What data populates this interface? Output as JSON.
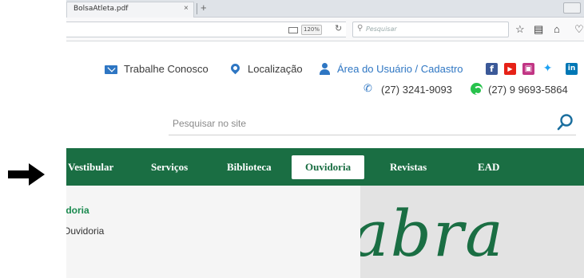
{
  "browser": {
    "tab_title": "BolsaAtleta.pdf",
    "tab_close": "×",
    "new_tab": "+",
    "zoom": "120%",
    "search_placeholder": "Pesquisar"
  },
  "header": {
    "links": {
      "work": "Trabalhe Conosco",
      "location": "Localização",
      "user_area": "Área do Usuário / Cadastro"
    },
    "phone": "(27) 3241-9093",
    "whatsapp": "(27) 9 9693-5864",
    "search_placeholder": "Pesquisar no site"
  },
  "nav": {
    "items": [
      "Vestibular",
      "Serviços",
      "Biblioteca",
      "Ouvidoria",
      "Revistas",
      "EAD"
    ],
    "active_index": 3
  },
  "content": {
    "section_title": "ıdoria",
    "section_item": "Ouvidoria",
    "banner_word": "abra"
  },
  "colors": {
    "nav_green": "#1a6e43",
    "link_blue": "#2e76c3",
    "facebook": "#3b5998",
    "youtube": "#e62117",
    "instagram": "#c13584",
    "twitter": "#1da1f2",
    "linkedin": "#0077b5",
    "whatsapp": "#27c24c"
  }
}
